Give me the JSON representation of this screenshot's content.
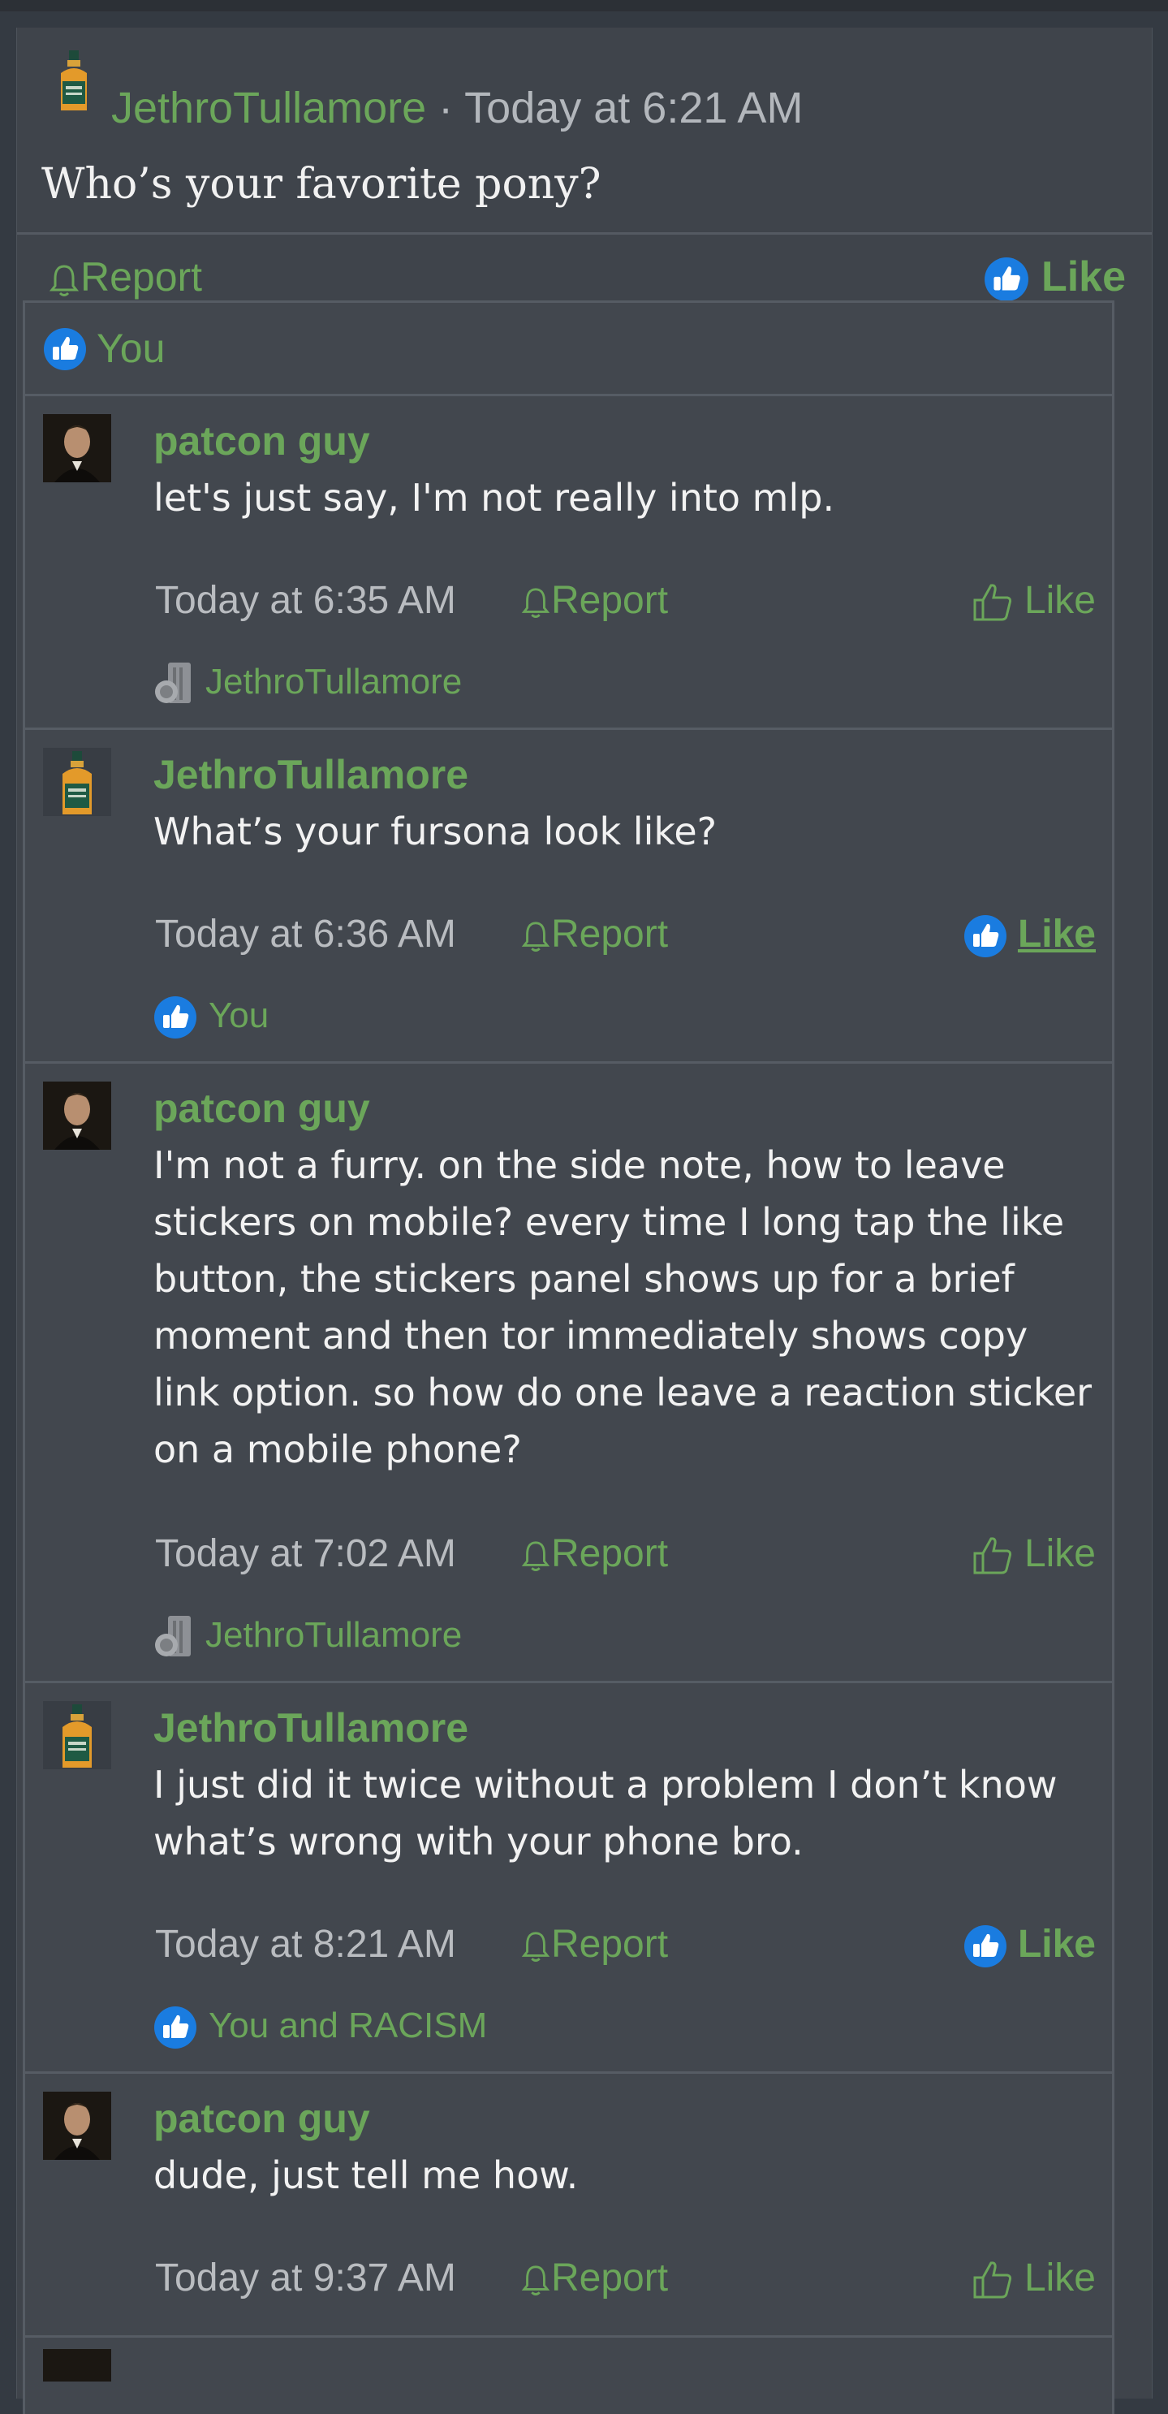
{
  "colors": {
    "accent": "#6ba65a",
    "like_blue": "#1a7ce0",
    "background": "#3f444b",
    "text": "#f2f2f2",
    "muted": "#b9bcc0"
  },
  "post": {
    "author": "JethroTullamore",
    "separator": " · ",
    "time": "Today at 6:21 AM",
    "text": "Who’s your favorite pony?",
    "report_label": "Report",
    "like_label": "Like",
    "reactions_text": "You"
  },
  "comments": [
    {
      "author": "patcon guy",
      "avatar": "portrait-avatar",
      "text": "let's just say, I'm not really into mlp.",
      "time": "Today at 6:35 AM",
      "report_label": "Report",
      "like_label": "Like",
      "liked": false,
      "reaction_icon": "sticker-medal-icon",
      "reaction_text": "JethroTullamore"
    },
    {
      "author": "JethroTullamore",
      "avatar": "bottle-avatar",
      "text": "What’s your fursona look like?",
      "time": "Today at 6:36 AM",
      "report_label": "Report",
      "like_label": "Like",
      "liked": true,
      "reaction_icon": "like-thumb-icon",
      "reaction_text": "You"
    },
    {
      "author": "patcon guy",
      "avatar": "portrait-avatar",
      "text": "I'm not a furry. on the side note, how to leave stickers on mobile? every time I long tap the like button, the stickers panel shows up for a brief moment and then tor immediately shows copy link option. so how do one leave a reaction sticker on a mobile phone?",
      "time": "Today at 7:02 AM",
      "report_label": "Report",
      "like_label": "Like",
      "liked": false,
      "reaction_icon": "sticker-medal-icon",
      "reaction_text": "JethroTullamore"
    },
    {
      "author": "JethroTullamore",
      "avatar": "bottle-avatar",
      "text": "I just did it twice without a problem I don’t know what’s wrong with your phone bro.",
      "time": "Today at 8:21 AM",
      "report_label": "Report",
      "like_label": "Like",
      "liked": true,
      "reaction_icon": "like-thumb-icon",
      "reaction_text": "You and RACISM"
    },
    {
      "author": "patcon guy",
      "avatar": "portrait-avatar",
      "text": "dude, just tell me how.",
      "time": "Today at 9:37 AM",
      "report_label": "Report",
      "like_label": "Like",
      "liked": false
    }
  ]
}
